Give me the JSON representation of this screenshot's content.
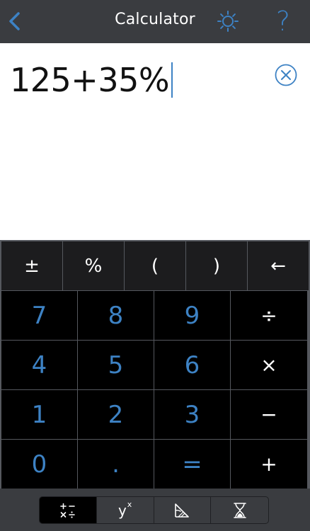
{
  "header": {
    "title": "Calculator",
    "back_icon": "chevron-left-icon",
    "settings_icon": "sun-gear-icon",
    "help_icon": "question-mark-icon",
    "help_glyph": "?"
  },
  "display": {
    "expression": "125+35%",
    "clear_icon": "circle-x-icon"
  },
  "keypad": {
    "function_row": [
      "±",
      "%",
      "(",
      ")",
      "←"
    ],
    "rows": [
      [
        "7",
        "8",
        "9",
        "÷"
      ],
      [
        "4",
        "5",
        "6",
        "×"
      ],
      [
        "1",
        "2",
        "3",
        "−"
      ],
      [
        "0",
        ".",
        "=",
        "+"
      ]
    ]
  },
  "tabs": [
    {
      "name": "basic-operations",
      "icon": "plus-minus-times-divide-icon",
      "active": true
    },
    {
      "name": "power",
      "label_base": "y",
      "label_sup": "x",
      "active": false
    },
    {
      "name": "geometry",
      "icon": "triangle-angle-icon",
      "active": false
    },
    {
      "name": "time",
      "icon": "hourglass-icon",
      "active": false
    }
  ],
  "colors": {
    "accent": "#3d82c4",
    "header_bg": "#3a3c40",
    "display_bg": "#ffffff",
    "key_bg": "#000000",
    "func_key_bg": "#1c1c1e"
  }
}
